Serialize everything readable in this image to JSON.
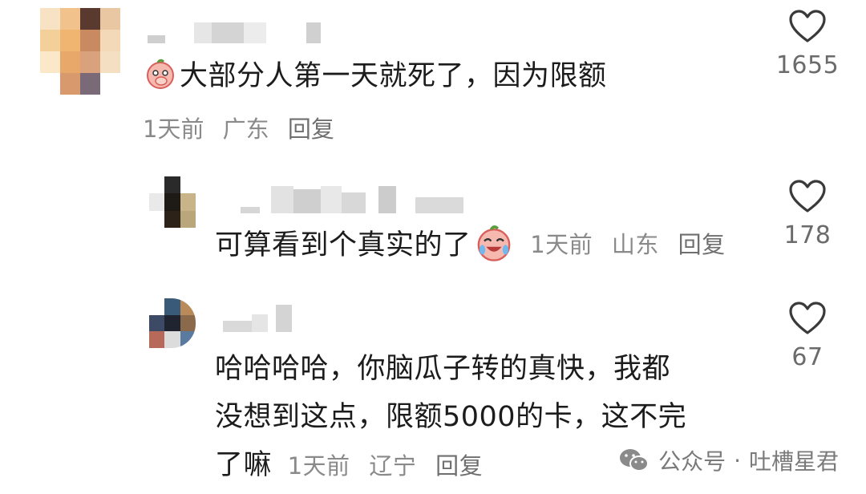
{
  "comments": [
    {
      "text": "大部分人第一天就死了，因为限额",
      "time": "1天前",
      "location": "广东",
      "reply_label": "回复",
      "likes": "1655",
      "emoji_icon": "covering-mouth-emoji-icon"
    },
    {
      "text": "可算看到个真实的了",
      "time": "1天前",
      "location": "山东",
      "reply_label": "回复",
      "likes": "178",
      "emoji_icon": "laughing-crying-emoji-icon"
    },
    {
      "text_line1": "哈哈哈哈，你脑瓜子转的真快，我都",
      "text_line2": "没想到这点，限额5000的卡，这不完",
      "text_line3": "了嘛",
      "time": "1天前",
      "location": "辽宁",
      "reply_label": "回复",
      "likes": "67"
    }
  ],
  "watermark": {
    "label": "公众号",
    "separator": "·",
    "account": "吐槽星君",
    "icon": "wechat-icon"
  },
  "colors": {
    "text": "#1c1c1c",
    "meta": "#8a8a8a",
    "heart": "#3a3a3a"
  }
}
